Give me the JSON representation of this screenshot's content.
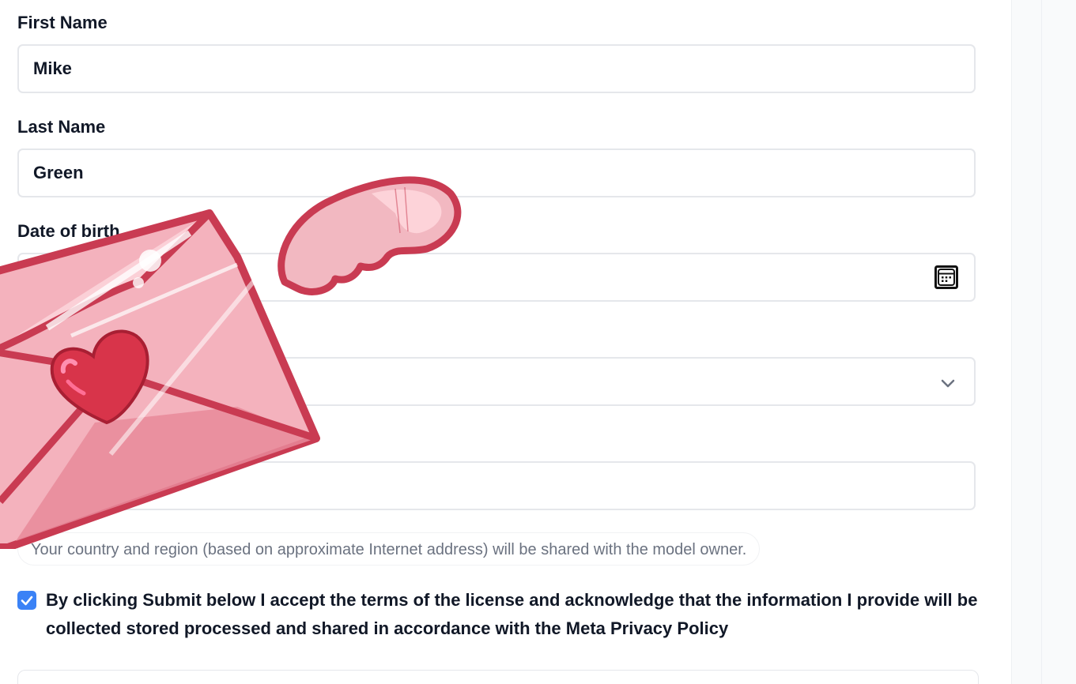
{
  "form": {
    "first_name": {
      "label": "First Name",
      "value": "Mike"
    },
    "last_name": {
      "label": "Last Name",
      "value": "Green"
    },
    "date_of_birth": {
      "label": "Date of birth",
      "value": ""
    },
    "select_field": {
      "value": ""
    },
    "text_field": {
      "value": ""
    },
    "notice": "Your country and region (based on approximate Internet address) will be shared with the model owner.",
    "consent": {
      "checked": true,
      "text": "By clicking Submit below I accept the terms of the license and acknowledge that the information I provide will be collected stored processed and shared in accordance with the Meta Privacy Policy"
    }
  },
  "icons": {
    "calendar": "calendar-icon",
    "chevron": "chevron-down-icon",
    "check": "check-icon",
    "sticker": "love-letter-sticker"
  },
  "colors": {
    "checkbox": "#3b82f6",
    "border": "#e5e7eb",
    "notice_text": "#6b7280"
  }
}
